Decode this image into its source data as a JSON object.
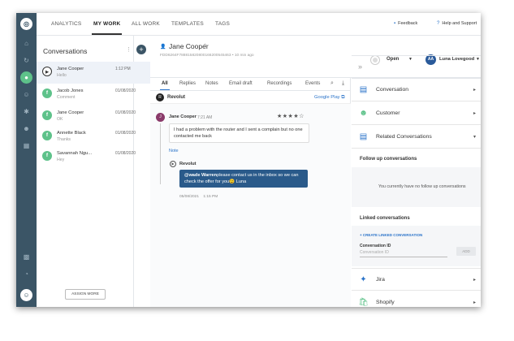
{
  "topnav": {
    "tabs": [
      "ANALYTICS",
      "MY WORK",
      "ALL WORK",
      "TEMPLATES",
      "TAGS"
    ],
    "active_tab": "MY WORK",
    "feedback": "Feedback",
    "help": "Help and Support"
  },
  "conversations": {
    "title": "Conversations",
    "items": [
      {
        "name": "Jane Cooper",
        "preview": "Hello",
        "time": "1:12 PM",
        "avatar": "play"
      },
      {
        "name": "Jacob Jones",
        "preview": "Comment",
        "time": "01/08/2020",
        "avatar": "f"
      },
      {
        "name": "Jane Cooper",
        "preview": "OK",
        "time": "01/08/2020",
        "avatar": "f"
      },
      {
        "name": "Annette Black",
        "preview": "Thanks",
        "time": "01/08/2020",
        "avatar": "f"
      },
      {
        "name": "Savannah Ngu...",
        "preview": "Hey",
        "time": "01/08/2020",
        "avatar": "f"
      }
    ],
    "assign_more": "ASSIGN MORE"
  },
  "header": {
    "name": "Jane Cooper",
    "id_line": "FDD6264F788815820800166200545463",
    "ago": "10 min ago",
    "status": "Open",
    "user_initials": "AA",
    "user_name": "Luna Lovegood"
  },
  "tabs": [
    "All",
    "Replies",
    "Notes",
    "Email draft",
    "Recordings",
    "Events"
  ],
  "active_tab": "All",
  "source": {
    "name": "Revolut",
    "link": "Google Play"
  },
  "messages": {
    "customer": {
      "name": "Jane Cooper",
      "time": "7:21 AM",
      "rating": 4,
      "text_line1": "I had a problem with the router and I sent a complain but no one",
      "text_line2": "contacted me back"
    },
    "note_label": "Note",
    "reply": {
      "name": "Revolut",
      "mention": "@wade Warren",
      "text_line1": "please contact us in the inbox so we can",
      "text_line2": "check the offer for you😉 Luna",
      "date": "05/08/2021",
      "time": "1:15 PM"
    }
  },
  "right_panel": {
    "sections": [
      "Conversation",
      "Customer",
      "Related Conversations"
    ],
    "follow_up_title": "Follow up conversations",
    "follow_up_empty": "You currently have no follow up conversations",
    "linked_title": "Linked conversations",
    "create_link": "+ CREATE LINKED CONVERSATION",
    "conv_id_label": "Conversation ID",
    "conv_id_placeholder": "Conversation ID",
    "add_label": "ADD",
    "apps": [
      "Jira",
      "Shopify"
    ]
  },
  "colors": {
    "rail": "#3b5566",
    "accent_green": "#5ec28a",
    "link_blue": "#2a73c9",
    "reply_bubble": "#2a5a8a"
  }
}
